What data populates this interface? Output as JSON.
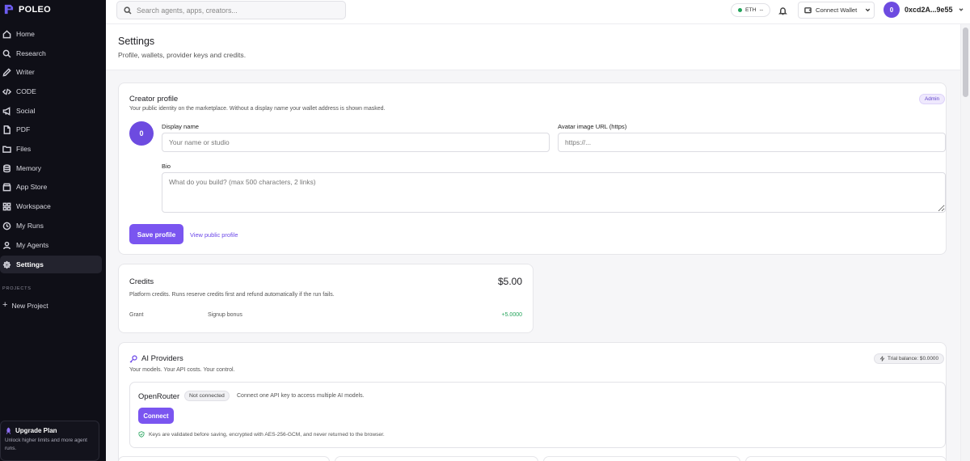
{
  "app": {
    "brand": "POLEO"
  },
  "sidebar": {
    "items": [
      {
        "label": "Home",
        "icon": "home-icon"
      },
      {
        "label": "Research",
        "icon": "search-icon"
      },
      {
        "label": "Writer",
        "icon": "pen-icon"
      },
      {
        "label": "CODE",
        "icon": "code-icon"
      },
      {
        "label": "Social",
        "icon": "megaphone-icon"
      },
      {
        "label": "PDF",
        "icon": "file-icon"
      },
      {
        "label": "Files",
        "icon": "folder-icon"
      },
      {
        "label": "Memory",
        "icon": "database-icon"
      },
      {
        "label": "App Store",
        "icon": "store-icon"
      },
      {
        "label": "Workspace",
        "icon": "grid-icon"
      },
      {
        "label": "My Runs",
        "icon": "clock-icon"
      },
      {
        "label": "My Agents",
        "icon": "agents-icon"
      },
      {
        "label": "Settings",
        "icon": "gear-icon",
        "active": true
      }
    ],
    "projects_label": "PROJECTS",
    "new_project": "New Project",
    "upgrade": {
      "title": "Upgrade Plan",
      "desc": "Unlock higher limits and more agent runs."
    }
  },
  "topbar": {
    "search_placeholder": "Search agents, apps, creators...",
    "network": "ETH",
    "network_status": "--",
    "wallet_button": "Connect Wallet",
    "avatar_letter": "0",
    "address": "0xcd2A...9e55"
  },
  "page": {
    "title": "Settings",
    "subtitle": "Profile, wallets, provider keys and credits."
  },
  "creator_profile": {
    "title": "Creator profile",
    "subtitle": "Your public identity on the marketplace. Without a display name your wallet address is shown masked.",
    "badge": "Admin",
    "avatar_letter": "0",
    "display_name_label": "Display name",
    "display_name_placeholder": "Your name or studio",
    "avatar_url_label": "Avatar image URL (https)",
    "avatar_url_placeholder": "https://...",
    "bio_label": "Bio",
    "bio_placeholder": "What do you build? (max 500 characters, 2 links)",
    "save_button": "Save profile",
    "view_link": "View public profile"
  },
  "credits": {
    "title": "Credits",
    "amount": "$5.00",
    "subtitle": "Platform credits. Runs reserve credits first and refund automatically if the run fails.",
    "rows": [
      {
        "type": "Grant",
        "desc": "Signup bonus",
        "amount": "+5.0000"
      }
    ]
  },
  "ai_providers": {
    "title": "AI Providers",
    "subtitle": "Your models. Your API costs. Your control.",
    "trial_badge": "Trial balance: $0.0000",
    "provider": {
      "name": "OpenRouter",
      "status": "Not connected",
      "desc": "Connect one API key to access multiple AI models.",
      "connect_button": "Connect",
      "note": "Keys are validated before saving, encrypted with AES-256-GCM, and never returned to the browser."
    }
  },
  "colors": {
    "accent": "#7a55f0",
    "sidebar_bg": "#0f0f17",
    "positive": "#22a35a"
  }
}
